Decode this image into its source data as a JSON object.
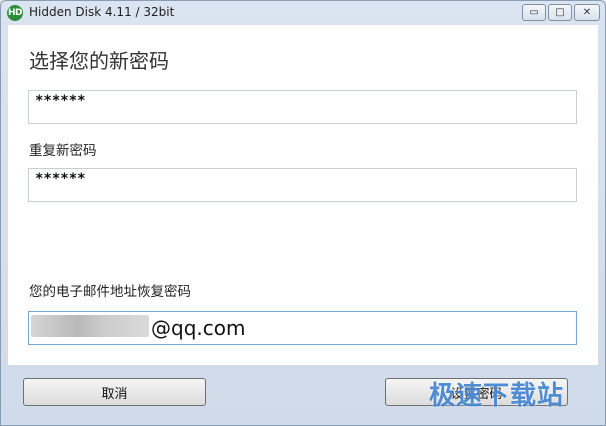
{
  "window": {
    "title": "Hidden Disk 4.11 / 32bit",
    "logo_text": "HD",
    "controls": {
      "minimize": "▭",
      "maximize": "□",
      "close": "✕"
    }
  },
  "form": {
    "heading": "选择您的新密码",
    "password_value": "******",
    "repeat_label": "重复新密码",
    "repeat_value": "******",
    "email_label": "您的电子邮件地址恢复密码",
    "email_visible_part": "@qq.com"
  },
  "buttons": {
    "cancel": "取消",
    "set_password": "设置密码"
  },
  "watermark": "极速下载站",
  "colors": {
    "frame": "#cfdbea",
    "email_border": "#7aa7d8",
    "watermark": "#1e6ec8"
  }
}
